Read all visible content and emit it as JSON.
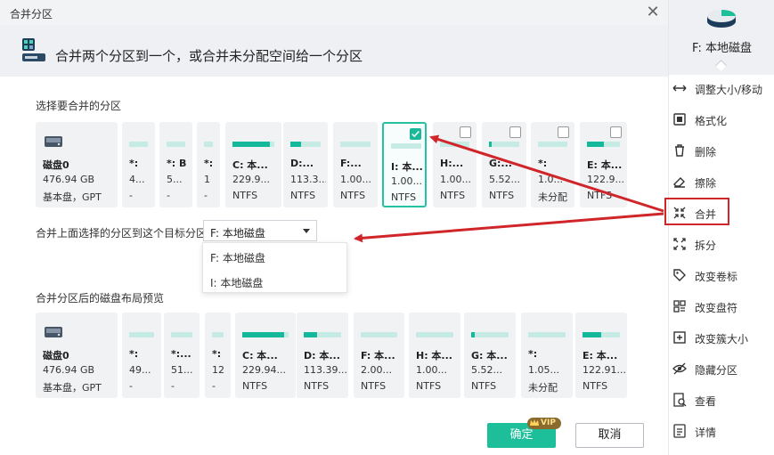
{
  "window": {
    "title": "合并分区"
  },
  "header": {
    "title": "合并两个分区到一个，或合并未分配空间给一个分区"
  },
  "section1": {
    "label": "选择要合并的分区"
  },
  "disk": {
    "name": "磁盘0",
    "size": "476.94  GB",
    "type": "基本盘，GPT"
  },
  "partitions": [
    {
      "name": "*:",
      "size": "4...",
      "fs": "-",
      "fill": 0
    },
    {
      "name": "*: B",
      "size": "5...",
      "fs": "-",
      "fill": 0
    },
    {
      "name": "*:",
      "size": "1",
      "fs": "-",
      "fill": 0
    },
    {
      "name": "C: 本...",
      "size": "229.9...",
      "fs": "NTFS",
      "fill": 0.9
    },
    {
      "name": "D:...",
      "size": "113.3...",
      "fs": "NTFS",
      "fill": 0.35
    },
    {
      "name": "F:...",
      "size": "1.00...",
      "fs": "NTFS",
      "fill": 0
    },
    {
      "name": "I: 本...",
      "size": "1.00...",
      "fs": "NTFS",
      "fill": 0,
      "selected": true
    },
    {
      "name": "H:...",
      "size": "1.00...",
      "fs": "NTFS",
      "fill": 0
    },
    {
      "name": "G:...",
      "size": "5.52...",
      "fs": "NTFS",
      "fill": 0.1
    },
    {
      "name": "*:",
      "size": "1.0...",
      "fs": "未分配",
      "fill": 0
    },
    {
      "name": "E: 本...",
      "size": "122.9...",
      "fs": "NTFS",
      "fill": 0.5
    }
  ],
  "target": {
    "label": "合并上面选择的分区到这个目标分区",
    "value": "F: 本地磁盘",
    "options": [
      "F: 本地磁盘",
      "I: 本地磁盘"
    ]
  },
  "preview": {
    "label": "合并分区后的磁盘布局预览",
    "partitions": [
      {
        "name": "*:",
        "size": "49...",
        "fs": "-",
        "fill": 0
      },
      {
        "name": "*:...",
        "size": "51...",
        "fs": "-",
        "fill": 0
      },
      {
        "name": "*:",
        "size": "12",
        "fs": "-",
        "fill": 0
      },
      {
        "name": "C: 本...",
        "size": "229.94...",
        "fs": "NTFS",
        "fill": 0.9
      },
      {
        "name": "D: 本...",
        "size": "113.39...",
        "fs": "NTFS",
        "fill": 0.35
      },
      {
        "name": "F: 本...",
        "size": "2.00...",
        "fs": "NTFS",
        "fill": 0
      },
      {
        "name": "H: 本...",
        "size": "1.00...",
        "fs": "NTFS",
        "fill": 0
      },
      {
        "name": "G: 本...",
        "size": "5.52...",
        "fs": "NTFS",
        "fill": 0.1
      },
      {
        "name": "*:",
        "size": "1.05...",
        "fs": "未分配",
        "fill": 0
      },
      {
        "name": "E: 本...",
        "size": "122.91...",
        "fs": "NTFS",
        "fill": 0.5
      }
    ]
  },
  "buttons": {
    "ok": "确定",
    "cancel": "取消",
    "vip": "VIP"
  },
  "sidebar": {
    "disk_name": "F: 本地磁盘",
    "items": [
      {
        "label": "调整大小/移动",
        "icon": "resize-move-icon"
      },
      {
        "label": "格式化",
        "icon": "format-icon"
      },
      {
        "label": "删除",
        "icon": "delete-icon"
      },
      {
        "label": "擦除",
        "icon": "eraser-icon"
      },
      {
        "label": "合并",
        "icon": "merge-icon"
      },
      {
        "label": "拆分",
        "icon": "split-icon"
      },
      {
        "label": "改变卷标",
        "icon": "tag-icon"
      },
      {
        "label": "改变盘符",
        "icon": "drive-letter-icon"
      },
      {
        "label": "改变簇大小",
        "icon": "cluster-icon"
      },
      {
        "label": "隐藏分区",
        "icon": "hide-icon"
      },
      {
        "label": "查看",
        "icon": "view-icon"
      },
      {
        "label": "详情",
        "icon": "details-icon"
      }
    ]
  },
  "colors": {
    "accent": "#1cbf9a",
    "annotation": "#d0262a"
  }
}
